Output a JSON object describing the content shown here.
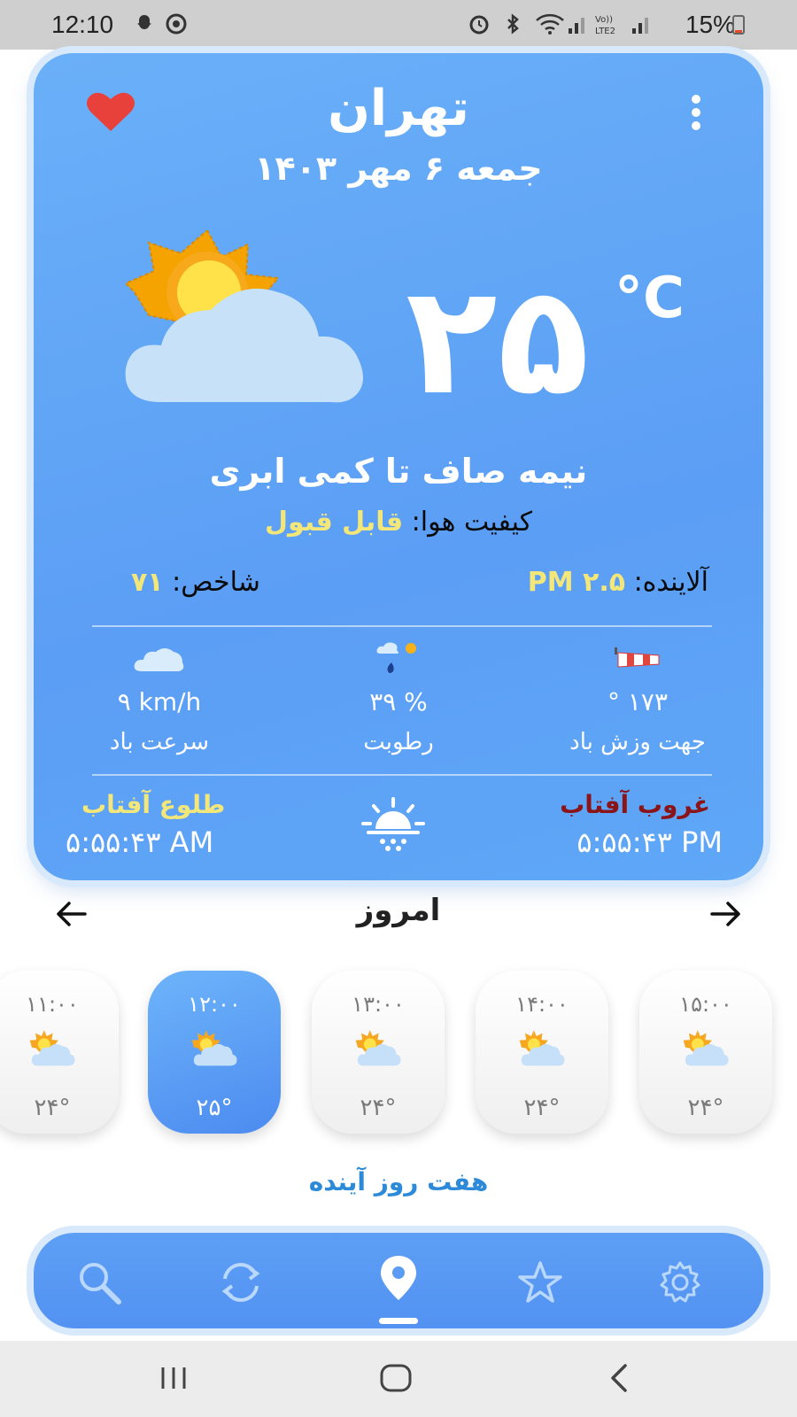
{
  "status_bar": {
    "time": "12:10",
    "battery": "15%"
  },
  "weather": {
    "city": "تهران",
    "date": "جمعه ۶ مهر ۱۴۰۳",
    "temperature": "۲۵",
    "unit": "°C",
    "condition": "نیمه صاف تا کمی ابری",
    "air_quality_label": "کیفیت هوا:",
    "air_quality_value": "قابل قبول",
    "pollutant_label": "آلاینده:",
    "pollutant_value": "PM ۲.۵",
    "index_label": "شاخص:",
    "index_value": "۷۱",
    "wind_direction_value": "° ۱۷۳",
    "wind_direction_label": "جهت وزش باد",
    "humidity_value": "۳۹ %",
    "humidity_label": "رطوبت",
    "wind_speed_value": "۹ km/h",
    "wind_speed_label": "سرعت باد",
    "sunset_label": "غروب آفتاب",
    "sunset_time": "۵:۵۵:۴۳ PM",
    "sunrise_label": "طلوع آفتاب",
    "sunrise_time": "۵:۵۵:۴۳ AM"
  },
  "day_nav": {
    "title": "امروز"
  },
  "hourly": [
    {
      "time": "۱۱:۰۰",
      "temp": "۲۴°",
      "icon": "partly-cloudy-icon"
    },
    {
      "time": "۱۲:۰۰",
      "temp": "۲۵°",
      "icon": "partly-cloudy-icon",
      "active": true
    },
    {
      "time": "۱۳:۰۰",
      "temp": "۲۴°",
      "icon": "partly-cloudy-icon"
    },
    {
      "time": "۱۴:۰۰",
      "temp": "۲۴°",
      "icon": "partly-cloudy-icon"
    },
    {
      "time": "۱۵:۰۰",
      "temp": "۲۴°",
      "icon": "partly-cloudy-icon"
    }
  ],
  "week_link": "هفت روز آینده",
  "bottom_nav": [
    "search-icon",
    "refresh-icon",
    "location-pin-icon",
    "star-icon",
    "settings-gear-icon"
  ],
  "colors": {
    "card_blue": "#5b9ef5",
    "accent_yellow": "#f4e77a",
    "sunset_red": "#8a1418",
    "link_blue": "#2d8ad8"
  }
}
